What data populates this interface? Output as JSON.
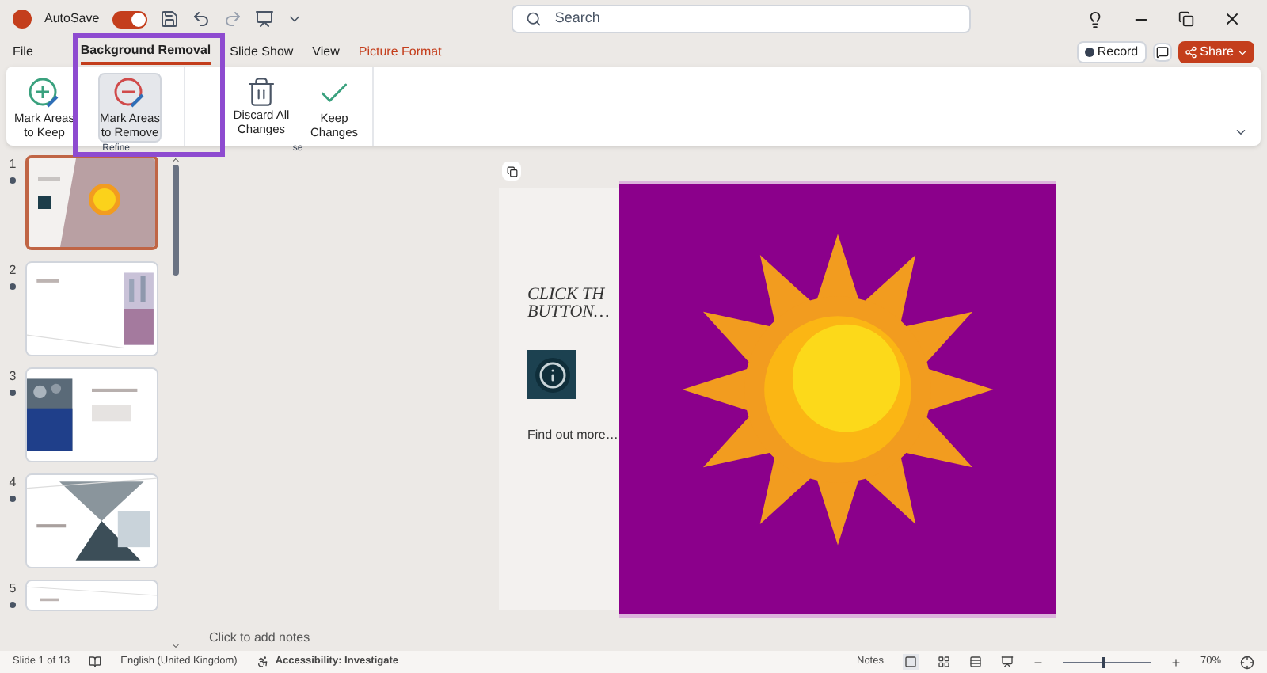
{
  "title_bar": {
    "autosave_label": "AutoSave",
    "autosave_on": true,
    "search_placeholder": "Search"
  },
  "menu_tabs": [
    {
      "label": "File",
      "selected": false,
      "kind": "plain"
    },
    {
      "label": "Background Removal",
      "selected": true,
      "kind": "plain"
    },
    {
      "label": "Slide Show",
      "selected": false,
      "kind": "plain"
    },
    {
      "label": "View",
      "selected": false,
      "kind": "plain"
    },
    {
      "label": "Picture Format",
      "selected": false,
      "kind": "contextual"
    }
  ],
  "record_button": "Record",
  "share_button": "Share",
  "ribbon": {
    "groups": [
      {
        "label": "Refine",
        "buttons": [
          {
            "label": "Mark Areas to Keep",
            "kind": "keep",
            "selected": false
          },
          {
            "label": "Mark Areas to Remove",
            "kind": "remove",
            "selected": true
          }
        ]
      },
      {
        "label": "se",
        "buttons": [
          {
            "label": "Discard All Changes",
            "kind": "discard",
            "selected": false
          },
          {
            "label": "Keep Changes",
            "kind": "check",
            "selected": false
          }
        ]
      }
    ]
  },
  "slides": [
    {
      "number": "1",
      "selected": true,
      "kind": "sun"
    },
    {
      "number": "2",
      "selected": false,
      "kind": "photo-right"
    },
    {
      "number": "3",
      "selected": false,
      "kind": "photo-left"
    },
    {
      "number": "4",
      "selected": false,
      "kind": "photo-center"
    },
    {
      "number": "5",
      "selected": false,
      "kind": "blank"
    }
  ],
  "slide": {
    "title_lines": [
      "CLICK TH",
      "BUTTON…"
    ],
    "link": "Find out more…"
  },
  "notes_placeholder": "Click to add notes",
  "status_bar": {
    "slide_count": "Slide 1 of 13",
    "language": "English (United Kingdom)",
    "accessibility": "Accessibility: Investigate",
    "notes": "Notes",
    "zoom": "70%",
    "level": 0.45
  }
}
